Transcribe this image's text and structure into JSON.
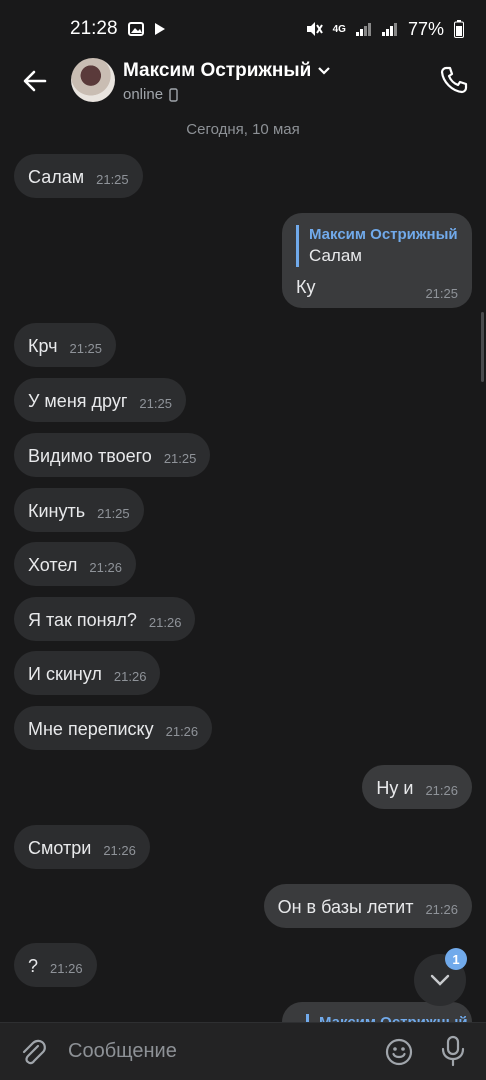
{
  "status_bar": {
    "time": "21:28",
    "battery": "77%",
    "network": "4G"
  },
  "header": {
    "contact_name": "Максим Острижный",
    "status": "online"
  },
  "chat": {
    "date_separator": "Сегодня, 10 мая",
    "messages": [
      {
        "text": "Салам",
        "time": "21:25",
        "direction": "in"
      },
      {
        "text": "Ку",
        "time": "21:25",
        "direction": "out",
        "reply_to": {
          "author": "Максим Острижный",
          "text": "Салам"
        }
      },
      {
        "text": "Крч",
        "time": "21:25",
        "direction": "in"
      },
      {
        "text": "У меня друг",
        "time": "21:25",
        "direction": "in"
      },
      {
        "text": "Видимо твоего",
        "time": "21:25",
        "direction": "in"
      },
      {
        "text": "Кинуть",
        "time": "21:25",
        "direction": "in"
      },
      {
        "text": "Хотел",
        "time": "21:26",
        "direction": "in"
      },
      {
        "text": "Я так понял?",
        "time": "21:26",
        "direction": "in"
      },
      {
        "text": "И скинул",
        "time": "21:26",
        "direction": "in"
      },
      {
        "text": "Мне переписку",
        "time": "21:26",
        "direction": "in"
      },
      {
        "text": "Ну и",
        "time": "21:26",
        "direction": "out"
      },
      {
        "text": "Смотри",
        "time": "21:26",
        "direction": "in"
      },
      {
        "text": "Он в базы летит",
        "time": "21:26",
        "direction": "out"
      },
      {
        "text": "?",
        "time": "21:26",
        "direction": "in"
      }
    ],
    "partial_reply_author": "Максим Острижный",
    "unread_badge": "1"
  },
  "composer": {
    "placeholder": "Сообщение"
  },
  "icons": {
    "back": "arrow-left-icon",
    "call": "phone-icon",
    "attach": "paperclip-icon",
    "emoji": "smile-icon",
    "mic": "microphone-icon",
    "scroll": "chevron-down-icon"
  },
  "colors": {
    "background": "#19191a",
    "bubble_in": "#2c2d2f",
    "bubble_out": "#3a3b3d",
    "accent": "#71aaeb"
  }
}
